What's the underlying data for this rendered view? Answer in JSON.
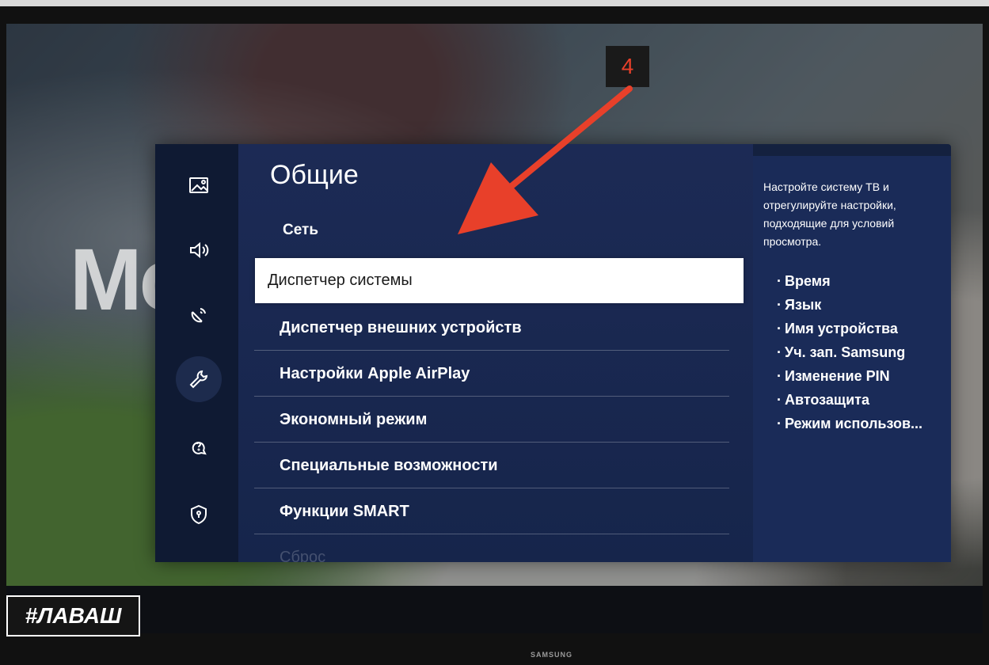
{
  "background": {
    "brand_text": "Mc",
    "logo_text": "#ЛАВАШ",
    "tv_brand": "SAMSUNG"
  },
  "sidebar": {
    "items": [
      {
        "icon": "picture-icon"
      },
      {
        "icon": "sound-icon"
      },
      {
        "icon": "broadcast-icon"
      },
      {
        "icon": "wrench-icon",
        "active": true
      },
      {
        "icon": "support-icon"
      },
      {
        "icon": "privacy-shield-icon"
      }
    ]
  },
  "main": {
    "title": "Общие",
    "network_label": "Сеть",
    "items": [
      "Диспетчер системы",
      "Диспетчер внешних устройств",
      "Настройки Apple AirPlay",
      "Экономный режим",
      "Специальные возможности",
      "Функции SMART",
      "Сброс"
    ],
    "selected_index": 0
  },
  "info": {
    "description": "Настройте систему ТВ и отрегулируйте настройки, подходящие для условий просмотра.",
    "bullets": [
      "Время",
      "Язык",
      "Имя устройства",
      "Уч. зап. Samsung",
      "Изменение PIN",
      "Автозащита",
      "Режим использов..."
    ]
  },
  "annotation": {
    "step": "4",
    "arrow_color": "#e8402a"
  }
}
